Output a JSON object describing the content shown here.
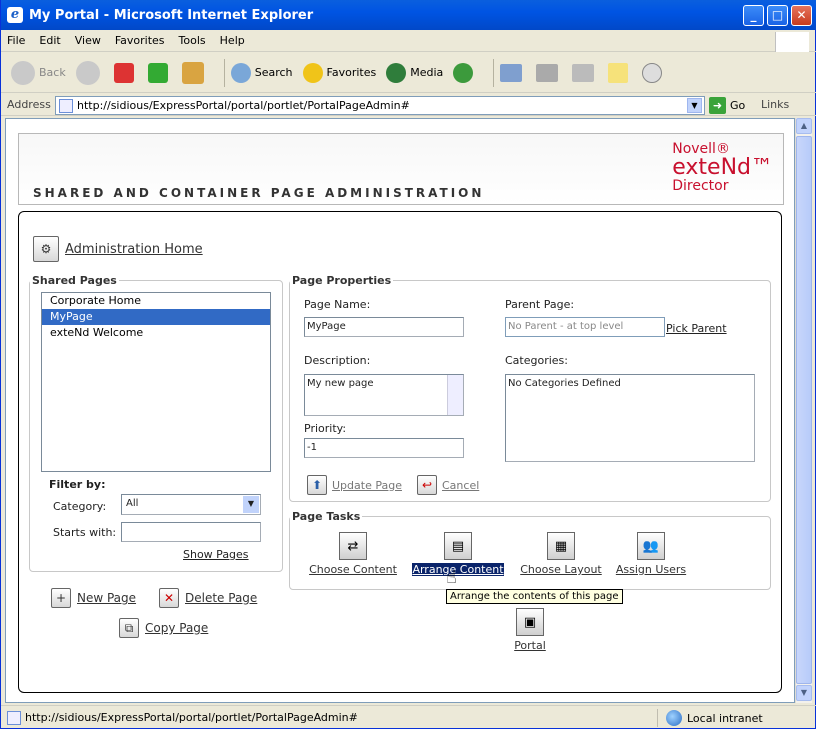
{
  "window": {
    "title": "My Portal - Microsoft Internet Explorer"
  },
  "menu": [
    "File",
    "Edit",
    "View",
    "Favorites",
    "Tools",
    "Help"
  ],
  "toolbar": {
    "back": "Back",
    "search": "Search",
    "favorites": "Favorites",
    "media": "Media"
  },
  "address": {
    "label": "Address",
    "url": "http://sidious/ExpressPortal/portal/portlet/PortalPageAdmin#",
    "go": "Go",
    "links": "Links"
  },
  "banner": {
    "title": "SHARED AND CONTAINER PAGE ADMINISTRATION",
    "brand_line1": "Novell®",
    "brand_line2": "exteNd™",
    "brand_line3": "Director"
  },
  "admin_home": "Administration Home",
  "shared_pages": {
    "legend": "Shared Pages",
    "items": [
      "Corporate Home",
      "MyPage",
      "exteNd Welcome"
    ],
    "selected_index": 1,
    "filter_by": "Filter by:",
    "category_label": "Category:",
    "category_value": "All",
    "starts_with_label": "Starts with:",
    "starts_with_value": "",
    "show_pages": "Show Pages"
  },
  "page_actions": {
    "new_page": "New Page",
    "delete_page": "Delete Page",
    "copy_page": "Copy Page"
  },
  "page_properties": {
    "legend": "Page Properties",
    "page_name_label": "Page Name:",
    "page_name_value": "MyPage",
    "parent_page_label": "Parent Page:",
    "parent_page_value": "No Parent - at top level",
    "pick_parent": "Pick Parent",
    "description_label": "Description:",
    "description_value": "My new page",
    "categories_label": "Categories:",
    "categories_value": "No Categories Defined",
    "priority_label": "Priority:",
    "priority_value": "-1",
    "update_page": "Update Page",
    "cancel": "Cancel"
  },
  "page_tasks": {
    "legend": "Page Tasks",
    "choose_content": "Choose Content",
    "arrange_content": "Arrange Content",
    "choose_layout": "Choose Layout",
    "assign_users": "Assign Users",
    "portal": "Portal",
    "tooltip": "Arrange the contents of this page"
  },
  "status": {
    "url": "http://sidious/ExpressPortal/portal/portlet/PortalPageAdmin#",
    "zone": "Local intranet"
  }
}
